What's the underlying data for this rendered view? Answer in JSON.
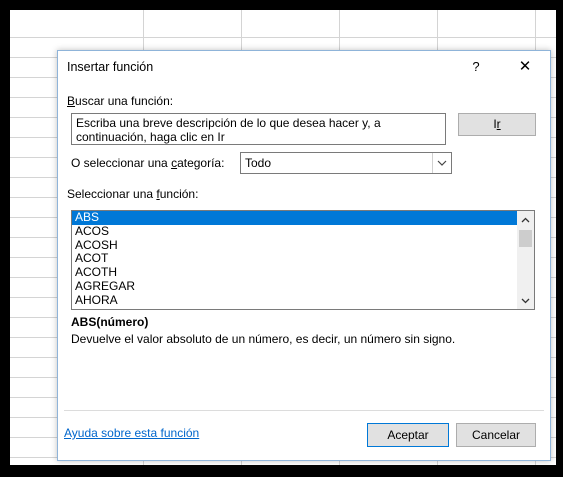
{
  "dialog": {
    "title": "Insertar función",
    "help_label": "?",
    "close_label": "✕"
  },
  "search": {
    "label_key": "B",
    "label_rest": "uscar una función:",
    "value": "Escriba una breve descripción de lo que desea hacer y, a continuación, haga clic en Ir",
    "go_button_prefix": "I",
    "go_button_key": "r"
  },
  "category": {
    "label_prefix": "O seleccionar una ",
    "label_key": "c",
    "label_rest": "ategoría:",
    "selected": "Todo",
    "dropdown_icon": "chevron-down-icon"
  },
  "functions": {
    "label_prefix": "Seleccionar una ",
    "label_key": "f",
    "label_rest": "unción:",
    "items": [
      "ABS",
      "ACOS",
      "ACOSH",
      "ACOT",
      "ACOTH",
      "AGREGAR",
      "AHORA"
    ],
    "selected_index": 0,
    "selection_color": "#0078d7"
  },
  "details": {
    "signature": "ABS(número)",
    "description": "Devuelve el valor absoluto de un número, es decir, un número sin signo."
  },
  "footer": {
    "help_link": "Ayuda sobre esta función",
    "ok_label": "Aceptar",
    "cancel_label": "Cancelar"
  }
}
